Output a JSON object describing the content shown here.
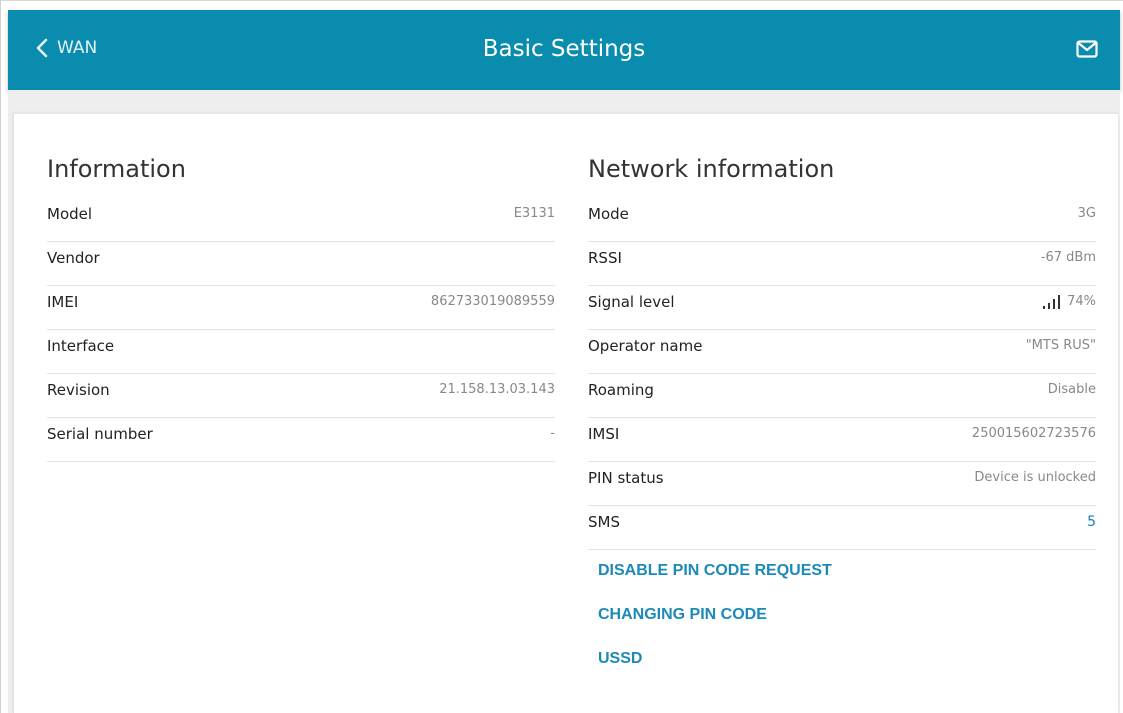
{
  "header": {
    "back_label": "WAN",
    "title": "Basic Settings",
    "back_icon": "chevron-left-icon",
    "mail_icon": "mail-icon",
    "background": "#0a8cae"
  },
  "info": {
    "title": "Information",
    "rows": [
      {
        "label": "Model",
        "value": "E3131"
      },
      {
        "label": "Vendor",
        "value": ""
      },
      {
        "label": "IMEI",
        "value": "862733019089559"
      },
      {
        "label": "Interface",
        "value": ""
      },
      {
        "label": "Revision",
        "value": "21.158.13.03.143"
      },
      {
        "label": "Serial number",
        "value": "-"
      }
    ]
  },
  "network": {
    "title": "Network information",
    "rows": [
      {
        "label": "Mode",
        "value": "3G"
      },
      {
        "label": "RSSI",
        "value": "-67 dBm"
      },
      {
        "label": "Signal level",
        "value": "74%"
      },
      {
        "label": "Operator name",
        "value": "\"MTS RUS\""
      },
      {
        "label": "Roaming",
        "value": "Disable"
      },
      {
        "label": "IMSI",
        "value": "250015602723576"
      },
      {
        "label": "PIN status",
        "value": "Device is unlocked"
      },
      {
        "label": "SMS",
        "value": "5"
      }
    ],
    "signal_bars_active": 4,
    "signal_bars_total": 4
  },
  "actions": {
    "disable_pin": "DISABLE PIN CODE REQUEST",
    "change_pin": "CHANGING PIN CODE",
    "ussd": "USSD"
  },
  "colors": {
    "accent": "#0a8cae",
    "link": "#1b8ab8",
    "label_text": "#222222",
    "value_text": "#888888"
  }
}
